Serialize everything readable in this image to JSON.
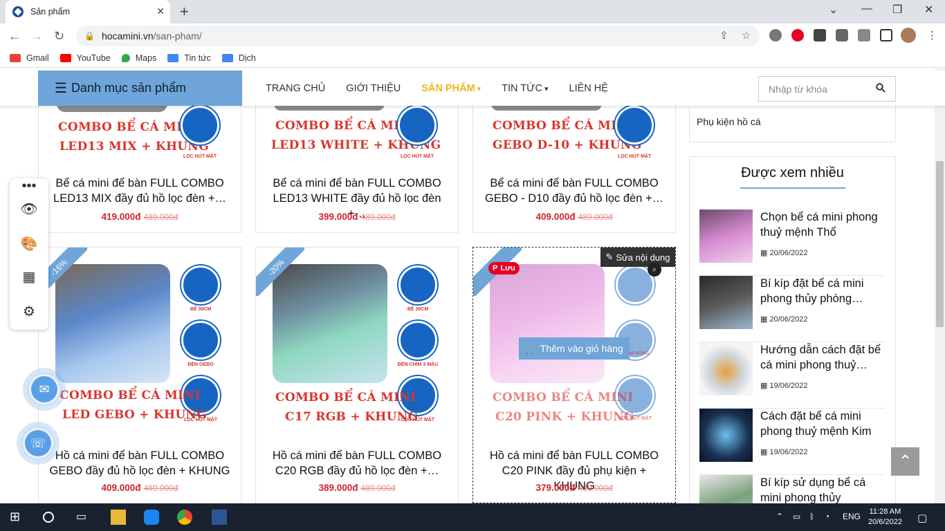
{
  "browser": {
    "tab_title": "Sản phẩm",
    "url_host": "hocamini.vn",
    "url_path": "/san-pham/",
    "bookmarks": [
      "Gmail",
      "YouTube",
      "Maps",
      "Tin tức",
      "Dịch"
    ]
  },
  "site": {
    "category_button": "Danh mục sản phẩm",
    "menu": [
      "TRANG CHỦ",
      "GIỚI THIỆU",
      "SẢN PHẨM",
      "TIN TỨC",
      "LIÊN HỆ"
    ],
    "search_placeholder": "Nhập từ khóa"
  },
  "products_top": [
    {
      "banner1": "COMBO BỂ CÁ MINI",
      "banner2": "LED13 MIX + KHUNG",
      "badge": "LỌC HÚT MẶT",
      "name": "Bể cá mini để bàn FULL COMBO LED13 MIX đầy đủ hồ lọc đèn +…",
      "price": "419.000đ",
      "old_price": "489.000đ"
    },
    {
      "banner1": "COMBO BỂ CÁ MINI",
      "banner2": "LED13 WHITE + KHUNG",
      "badge": "LỌC HÚT MẶT",
      "name": "Bể cá mini để bàn FULL COMBO LED13 WHITE đầy đủ hồ lọc đèn +…",
      "price": "399.000đ",
      "old_price": "489.000đ"
    },
    {
      "banner1": "COMBO BỂ CÁ MINI",
      "banner2": "GEBO D-10 + KHUNG",
      "badge": "LỌC HÚT MẶT",
      "name": "Bể cá mini để bàn FULL COMBO GEBO - D10 đầy đủ hồ lọc đèn +…",
      "price": "409.000đ",
      "old_price": "489.000đ"
    }
  ],
  "products_bottom": [
    {
      "discount": "-16%",
      "banner1": "COMBO BỂ CÁ MINI",
      "banner2": "LED GEBO + KHUNG",
      "badges": [
        "BỂ 30CM",
        "ĐÈN GEBO",
        "LỌC HÚT MẶT"
      ],
      "name": "Hồ cá mini để bàn FULL COMBO GEBO đầy đủ hồ lọc đèn + KHUNG",
      "price": "409.000đ",
      "old_price": "489.000đ"
    },
    {
      "discount": "-20%",
      "banner1": "COMBO BỂ CÁ MINI",
      "banner2": "C17 RGB + KHUNG",
      "badges": [
        "BỂ 30CM",
        "ĐÈN CHÌM 3 MÀU",
        "LỌC HÚT MẶT"
      ],
      "name": "Hồ cá mini để bàn FULL COMBO C20 RGB đầy đủ hồ lọc đèn +…",
      "price": "389.000đ",
      "old_price": "489.000đ"
    },
    {
      "discount": "%",
      "banner1": "COMBO BỂ CÁ MINI",
      "banner2": "C20 PINK + KHUNG",
      "badges": [
        "",
        "CHÌM HỒNG",
        "LỌC HÚT MẶT"
      ],
      "name": "Hồ cá mini để bàn FULL COMBO C20 PINK đầy đủ phụ kiện + KHUNG",
      "price": "379.000đ",
      "old_price": "489.000đ",
      "edit_label": "Sửa nội dung",
      "pin_label": "Lưu",
      "cart_label": "Thêm vào giỏ hàng"
    }
  ],
  "sidebar": {
    "top_item": "Phụ kiện hồ cá",
    "popular_title": "Được xem nhiều",
    "posts": [
      {
        "title": "Chọn bể cá mini phong thuỷ mệnh Thổ",
        "date": "20/06/2022"
      },
      {
        "title": "Bí kíp đặt bể cá mini phong thủy phòng…",
        "date": "20/06/2022"
      },
      {
        "title": "Hướng dẫn cách đặt bể cá mini phong thuỷ…",
        "date": "19/06/2022"
      },
      {
        "title": "Cách đặt bể cá mini phong thuỷ mệnh Kim",
        "date": "19/06/2022"
      },
      {
        "title": "Bí kíp sử dụng bể cá mini phong thủy người…",
        "date": ""
      }
    ]
  },
  "taskbar": {
    "lang": "ENG",
    "time": "11:28 AM",
    "date": "20/6/2022"
  }
}
